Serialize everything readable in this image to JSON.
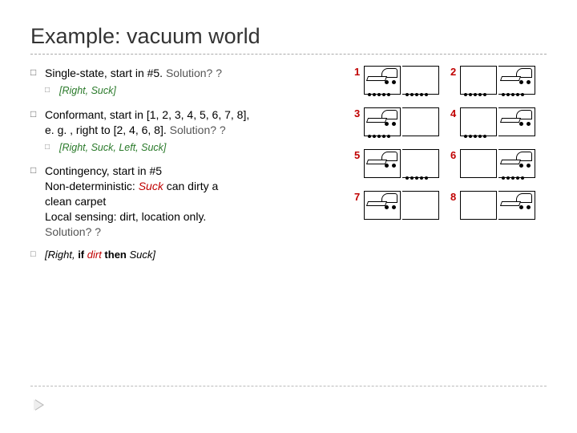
{
  "title": "Example: vacuum world",
  "bullets": {
    "b1": "Single-state, start in #5. ",
    "b1_sol": "Solution? ?",
    "b1_sub": "[Right, Suck]",
    "b2a": "Conformant, start in [1, 2, 3, 4, 5, 6, 7, 8],",
    "b2b": "e. g. , right to [2, 4, 6, 8]. ",
    "b2_sol": "Solution? ?",
    "b2_sub": "[Right, Suck, Left, Suck]",
    "b3a": "Contingency, start in #5",
    "b3b_pre": "Non-deterministic: ",
    "b3b_suck": "Suck",
    "b3b_post": " can dirty a",
    "b3c": "clean carpet",
    "b3d": "Local sensing: dirt, location only.",
    "b3_sol": "Solution? ?",
    "b4_pre": "[Right, ",
    "b4_if": "if ",
    "b4_dirt": "dirt",
    "b4_then": " then ",
    "b4_suck": "Suck]"
  },
  "states": {
    "ids": [
      "1",
      "2",
      "3",
      "4",
      "5",
      "6",
      "7",
      "8"
    ],
    "config": [
      {
        "vac": "L",
        "dirtL": true,
        "dirtR": true
      },
      {
        "vac": "R",
        "dirtL": true,
        "dirtR": true
      },
      {
        "vac": "L",
        "dirtL": true,
        "dirtR": false
      },
      {
        "vac": "R",
        "dirtL": true,
        "dirtR": false
      },
      {
        "vac": "L",
        "dirtL": false,
        "dirtR": true
      },
      {
        "vac": "R",
        "dirtL": false,
        "dirtR": true
      },
      {
        "vac": "L",
        "dirtL": false,
        "dirtR": false
      },
      {
        "vac": "R",
        "dirtL": false,
        "dirtR": false
      }
    ]
  }
}
